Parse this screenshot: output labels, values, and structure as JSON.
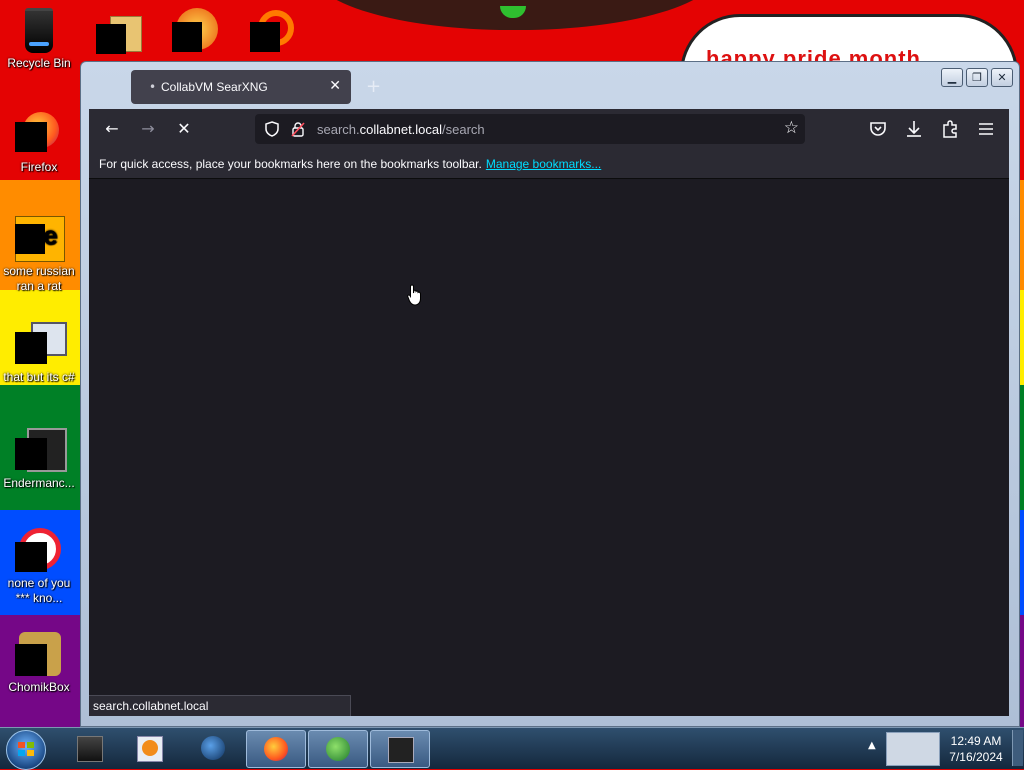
{
  "desktop": {
    "banner_text": "happy pride month",
    "icons": [
      {
        "name": "recycle-bin",
        "label": "Recycle Bin"
      },
      {
        "name": "firefox",
        "label": "Firefox"
      },
      {
        "name": "russian-rat",
        "label": "some russian ran a rat"
      },
      {
        "name": "that-but-its-c",
        "label": "that but its c#"
      },
      {
        "name": "endermanch",
        "label": "Endermanc..."
      },
      {
        "name": "none-of-you",
        "label": "none of you *** kno..."
      },
      {
        "name": "chomikbox",
        "label": "ChomikBox"
      }
    ]
  },
  "window": {
    "tab_title": "CollabVM SearXNG",
    "tab_close": "✕",
    "new_tab": "+",
    "controls": {
      "minimize": "▁",
      "maximize": "❐",
      "close": "✕"
    }
  },
  "toolbar": {
    "back": "←",
    "forward": "→",
    "stop": "✕",
    "url_host": "search.collabnet.local",
    "url_prefix": "search.",
    "url_domain": "collabnet.local",
    "url_path": "/search",
    "star": "☆"
  },
  "bookmarks_bar": {
    "text": "For quick access, place your bookmarks here on the bookmarks toolbar.",
    "link": "Manage bookmarks..."
  },
  "status": {
    "text": "search.collabnet.local"
  },
  "taskbar": {
    "time": "12:49 AM",
    "date": "7/16/2024",
    "tray_arrow": "▲"
  },
  "colors": {
    "browser_bg": "#1c1b22",
    "toolbar_bg": "#2b2a33",
    "link": "#00ddff",
    "taskbar": "#14283d"
  }
}
